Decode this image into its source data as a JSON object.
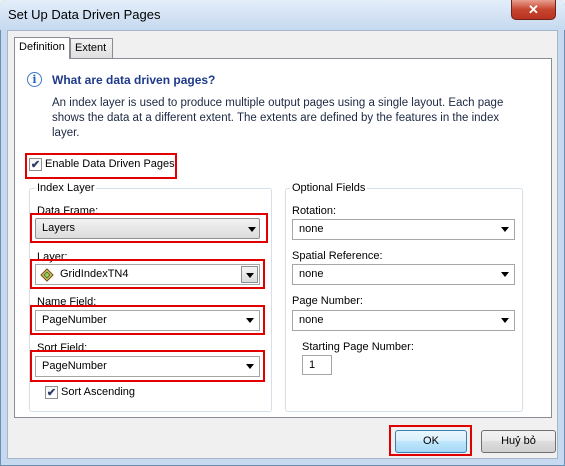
{
  "window": {
    "title": "Set Up Data Driven Pages",
    "close_glyph": "✕"
  },
  "tabs": [
    {
      "label": "Definition"
    },
    {
      "label": "Extent"
    }
  ],
  "info": {
    "icon": "info-icon",
    "icon_glyph": "i",
    "heading": "What are data driven pages?",
    "text": "An index layer is used to produce multiple output pages using a single layout.  Each page shows the data at a different extent.  The extents are defined by the features in the index layer."
  },
  "enable": {
    "label": "Enable Data Driven Pages",
    "checked": true,
    "check_glyph": "✔"
  },
  "index_layer": {
    "title": "Index Layer",
    "data_frame": {
      "label": "Data Frame:",
      "value": "Layers"
    },
    "layer": {
      "label": "Layer:",
      "value": "GridIndexTN4"
    },
    "name_field": {
      "label": "Name Field:",
      "value": "PageNumber"
    },
    "sort_field": {
      "label": "Sort Field:",
      "value": "PageNumber"
    },
    "sort_ascending": {
      "label": "Sort Ascending",
      "checked": true
    }
  },
  "optional_fields": {
    "title": "Optional Fields",
    "rotation": {
      "label": "Rotation:",
      "value": "none"
    },
    "spatial_reference": {
      "label": "Spatial Reference:",
      "value": "none"
    },
    "page_number": {
      "label": "Page Number:",
      "value": "none"
    },
    "starting_page_number": {
      "label": "Starting Page Number:",
      "value": "1"
    }
  },
  "buttons": {
    "ok": "OK",
    "cancel": "Huỷ bỏ"
  },
  "colors": {
    "highlight": "#e00000",
    "heading": "#1e3a8a"
  }
}
